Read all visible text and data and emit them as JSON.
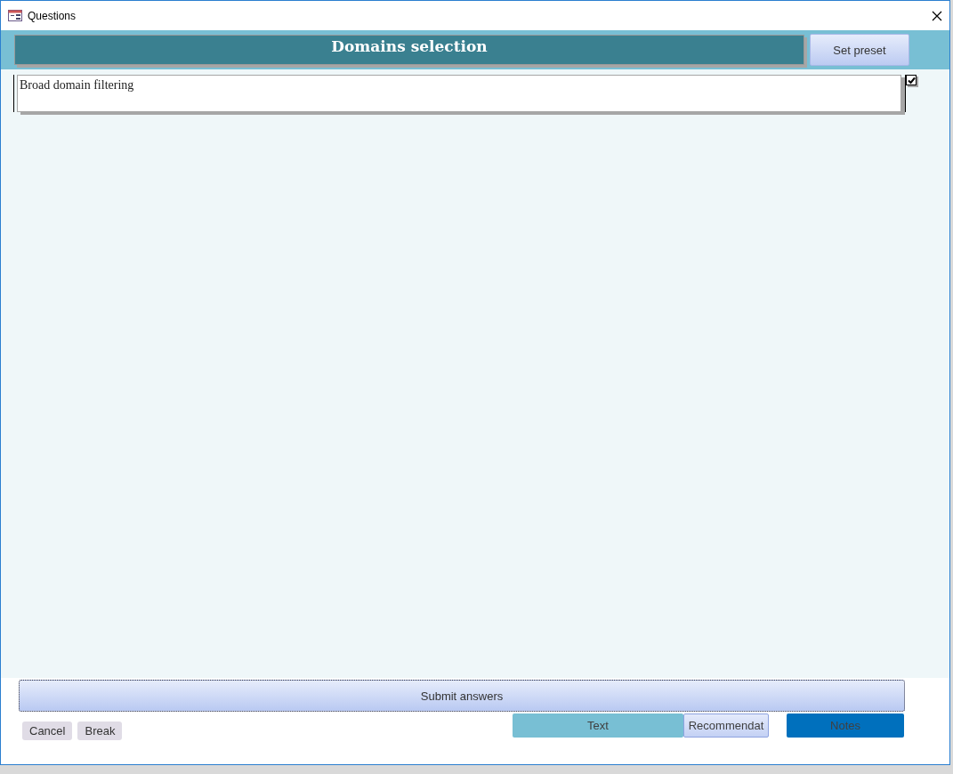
{
  "window": {
    "title": "Questions"
  },
  "header": {
    "title": "Domains selection",
    "preset_button": "Set preset"
  },
  "questions": [
    {
      "label": "Broad domain filtering",
      "checked": true
    }
  ],
  "submit_button": "Submit answers",
  "footer_buttons": [
    {
      "label": "Cancel",
      "kind": "plain"
    },
    {
      "label": "Break",
      "kind": "plain"
    }
  ],
  "view_tabs": [
    {
      "label": "Text",
      "kind": "light"
    },
    {
      "label": "Recommendat",
      "kind": "pale"
    },
    {
      "label": "Notes",
      "kind": "dark"
    }
  ]
}
